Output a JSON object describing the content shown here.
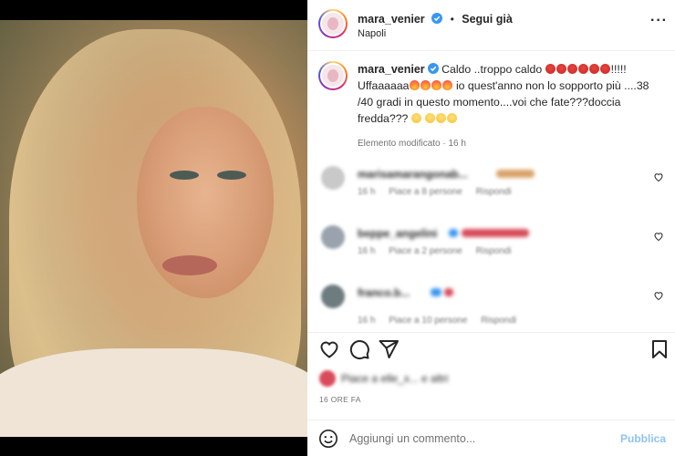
{
  "post": {
    "username": "mara_venier",
    "follow_label": "Segui già",
    "location": "Napoli"
  },
  "caption": {
    "username": "mara_venier",
    "part1": "Caldo ..troppo caldo ",
    "part2": "!!!!! Uffaaaaaa",
    "part3": " io quest'anno non lo sopporto più ....38 /40 gradi in questo momento....voi che fate???doccia fredda??? ",
    "meta": "Elemento modificato · 16 h"
  },
  "comments": [
    {
      "name": "marisamarangonab...",
      "text": "",
      "time": "16 h",
      "likes": "Piace a 8 persone",
      "reply": "Rispondi"
    },
    {
      "name": "beppe_angelini",
      "text": "",
      "time": "16 h",
      "likes": "Piace a 2 persone",
      "reply": "Rispondi"
    },
    {
      "name": "franco.b...",
      "text": "",
      "time": "16 h",
      "likes": "Piace a 10 persone",
      "reply": "Rispondi"
    }
  ],
  "likes_text": "Piace a elle_x... e altri",
  "time_ago": "16 ORE FA",
  "add_comment": {
    "placeholder": "Aggiungi un commento...",
    "publish_label": "Pubblica"
  },
  "colors": {
    "verified": "#3897f0",
    "publish": "#8fc3f3",
    "meta_gray": "#737373"
  },
  "icons": [
    "more-icon",
    "verified-icon",
    "heart-icon",
    "comment-icon",
    "share-icon",
    "bookmark-icon",
    "emoji-icon"
  ]
}
